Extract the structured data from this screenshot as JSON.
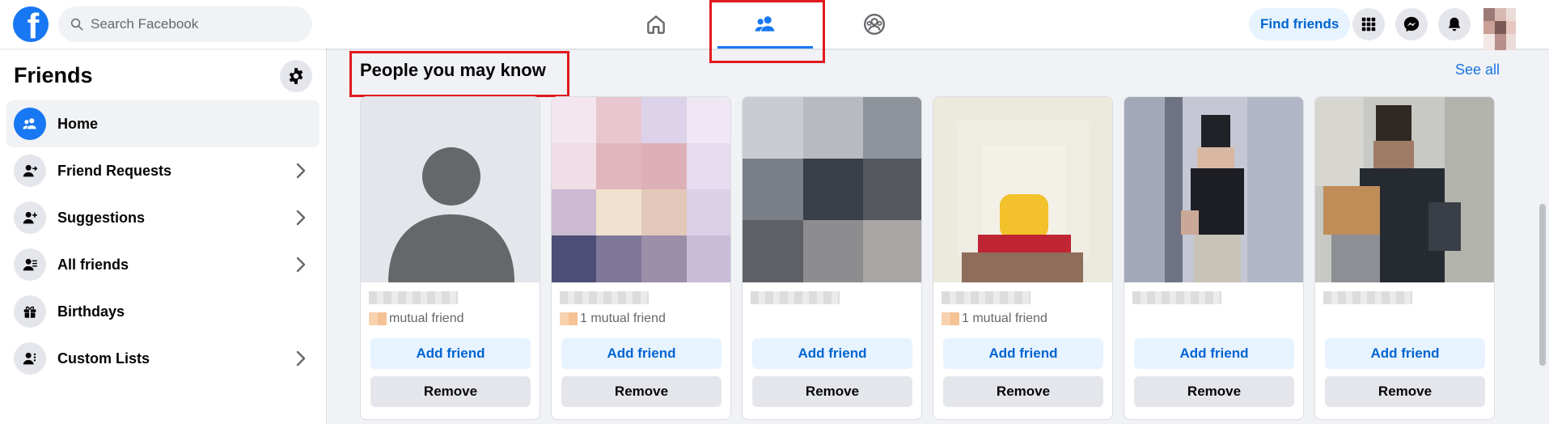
{
  "header": {
    "logo_letter": "f",
    "search_placeholder": "Search Facebook",
    "find_friends_label": "Find friends"
  },
  "sidebar": {
    "title": "Friends",
    "items": [
      {
        "label": "Home",
        "icon": "friends-icon",
        "active": true
      },
      {
        "label": "Friend Requests",
        "icon": "friend-request-icon",
        "chevron": true
      },
      {
        "label": "Suggestions",
        "icon": "add-friend-icon",
        "chevron": true
      },
      {
        "label": "All friends",
        "icon": "all-friends-icon",
        "chevron": true
      },
      {
        "label": "Birthdays",
        "icon": "gift-icon",
        "chevron": false
      },
      {
        "label": "Custom Lists",
        "icon": "custom-list-icon",
        "chevron": true
      }
    ]
  },
  "main": {
    "section_title": "People you may know",
    "see_all": "See all",
    "cards": [
      {
        "mutual": "mutual friend",
        "add": "Add friend",
        "remove": "Remove"
      },
      {
        "mutual": "1 mutual friend",
        "add": "Add friend",
        "remove": "Remove"
      },
      {
        "mutual": "",
        "add": "Add friend",
        "remove": "Remove"
      },
      {
        "mutual": "1 mutual friend",
        "add": "Add friend",
        "remove": "Remove"
      },
      {
        "mutual": "",
        "add": "Add friend",
        "remove": "Remove"
      },
      {
        "mutual": "",
        "add": "Add friend",
        "remove": "Remove"
      }
    ]
  },
  "colors": {
    "brand": "#1877f2",
    "link": "#1b74e4",
    "highlight": "#e1191e"
  }
}
